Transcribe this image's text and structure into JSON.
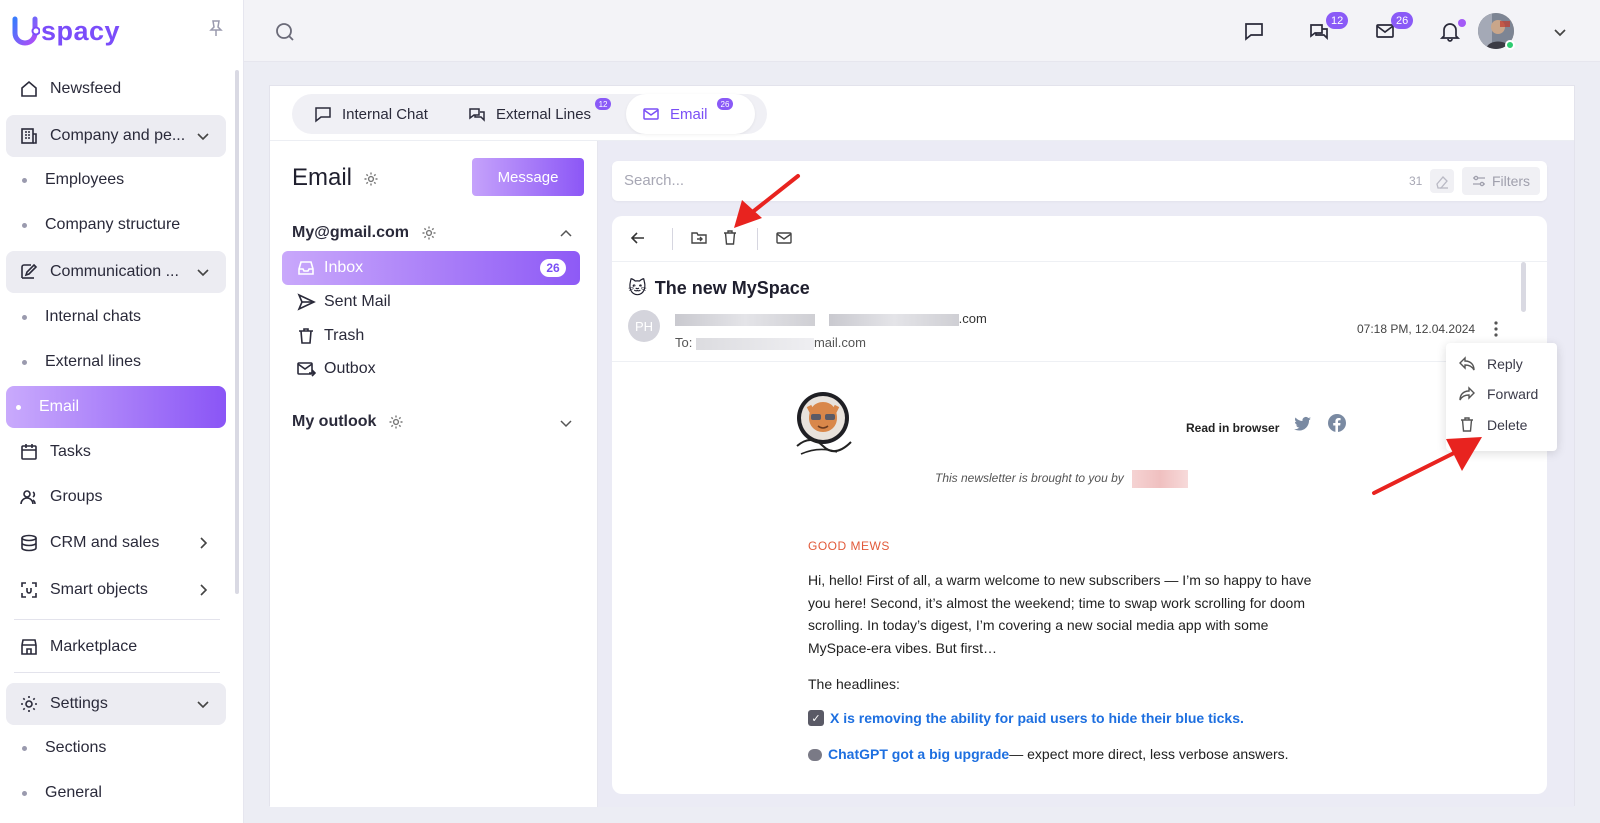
{
  "brand": {
    "name": "spacy"
  },
  "sidebar": {
    "items": [
      {
        "label": "Newsfeed"
      },
      {
        "label": "Company and pe..."
      },
      {
        "label": "Employees"
      },
      {
        "label": "Company structure"
      },
      {
        "label": "Communication ..."
      },
      {
        "label": "Internal chats"
      },
      {
        "label": "External lines"
      },
      {
        "label": "Email"
      },
      {
        "label": "Tasks"
      },
      {
        "label": "Groups"
      },
      {
        "label": "CRM and sales"
      },
      {
        "label": "Smart objects"
      },
      {
        "label": "Marketplace"
      },
      {
        "label": "Settings"
      },
      {
        "label": "Sections"
      },
      {
        "label": "General"
      }
    ]
  },
  "topbar": {
    "chats_badge": "12",
    "mail_badge": "26"
  },
  "tabs": [
    {
      "label": "Internal Chat"
    },
    {
      "label": "External Lines",
      "badge": "12"
    },
    {
      "label": "Email",
      "badge": "26"
    }
  ],
  "mail": {
    "title": "Email",
    "message_button": "Message",
    "accounts": [
      {
        "name": "My@gmail.com"
      },
      {
        "name": "My outlook"
      }
    ],
    "folders": [
      {
        "label": "Inbox",
        "count": "26"
      },
      {
        "label": "Sent Mail"
      },
      {
        "label": "Trash"
      },
      {
        "label": "Outbox"
      }
    ]
  },
  "search": {
    "placeholder": "Search...",
    "count": "31",
    "filters_label": "Filters"
  },
  "message": {
    "emoji": "🐱",
    "subject": "The new MySpace",
    "sender_initials": "PH",
    "from_visible_suffix": ".com",
    "to_prefix": "To:",
    "to_visible_suffix": "mail.com",
    "date": "07:18 PM, 12.04.2024",
    "read_in_browser": "Read in browser",
    "brought_by": "This newsletter is brought to you by",
    "section_label": "GOOD MEWS",
    "paragraph": "Hi, hello! First of all, a warm welcome to new subscribers — I’m so happy to have you here! Second, it’s almost the weekend; time to swap work scrolling for doom scrolling. In today’s digest, I’m covering a new social media app with some MySpace-era vibes. But first…",
    "headlines_label": "The headlines:",
    "headline_1": "X is removing the ability for paid users to hide their blue ticks.",
    "headline_2_link": "ChatGPT got a big upgrade",
    "headline_2_rest": "— expect more direct, less verbose answers."
  },
  "context_menu": [
    {
      "label": "Reply"
    },
    {
      "label": "Forward"
    },
    {
      "label": "Delete"
    }
  ],
  "colors": {
    "accent": "#8a5af7",
    "arrow": "#e8231f",
    "link": "#1d6fe0",
    "section_label": "#e25a3a"
  }
}
